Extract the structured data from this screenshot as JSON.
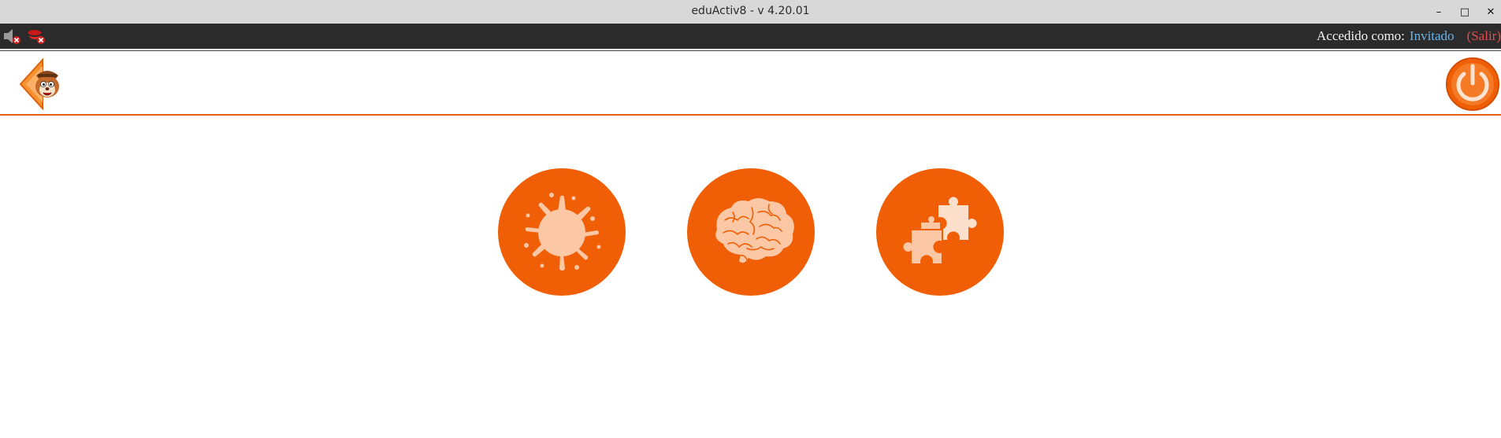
{
  "window": {
    "title": "eduActiv8 - v 4.20.01",
    "minimize_glyph": "–",
    "maximize_glyph": "□",
    "close_glyph": "✕"
  },
  "status": {
    "label": "Accedido como:",
    "user": "Invitado",
    "logout": "(Salir)",
    "icons": [
      "speaker-muted-icon",
      "microphone-muted-icon"
    ]
  },
  "toolbar": {
    "back_icon": "back-mascot-icon",
    "power_icon": "power-icon"
  },
  "activities": [
    {
      "icon": "paint-splat-icon"
    },
    {
      "icon": "brain-icon"
    },
    {
      "icon": "puzzle-icon"
    }
  ],
  "colors": {
    "accent": "#f05e05",
    "accent_light": "#fcc7a5",
    "status_bg": "#2b2b2b",
    "user_link": "#6cb4e8",
    "logout_link": "#e05050"
  }
}
